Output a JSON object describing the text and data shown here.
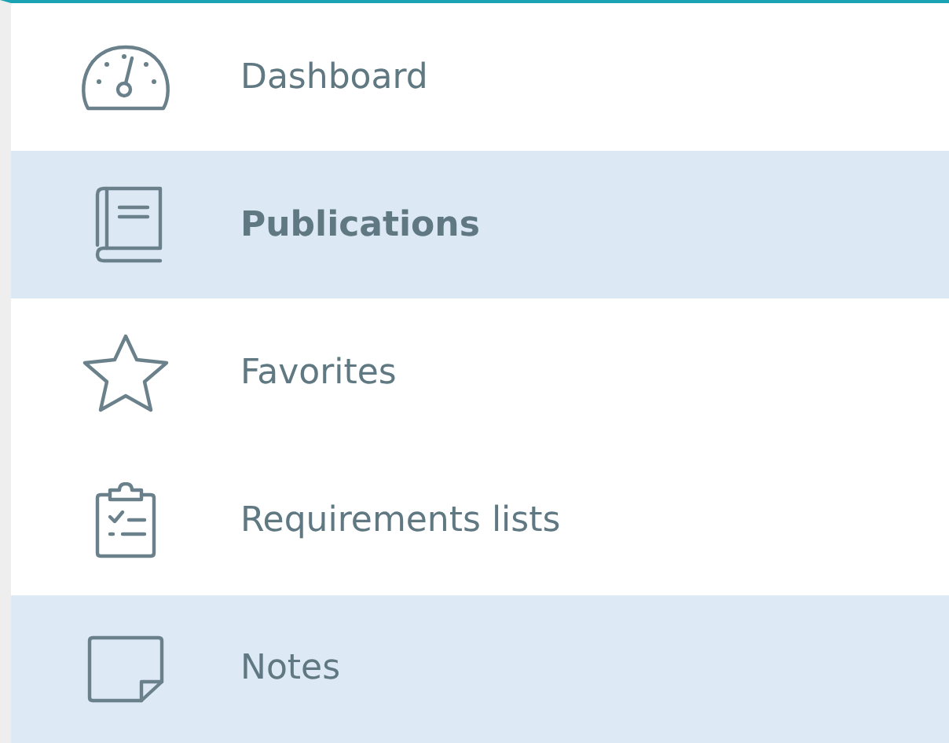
{
  "sidebar": {
    "items": [
      {
        "label": "Dashboard",
        "selected": false,
        "hovered": false
      },
      {
        "label": "Publications",
        "selected": true,
        "hovered": false
      },
      {
        "label": "Favorites",
        "selected": false,
        "hovered": false
      },
      {
        "label": "Requirements lists",
        "selected": false,
        "hovered": false
      },
      {
        "label": "Notes",
        "selected": false,
        "hovered": true
      }
    ]
  }
}
